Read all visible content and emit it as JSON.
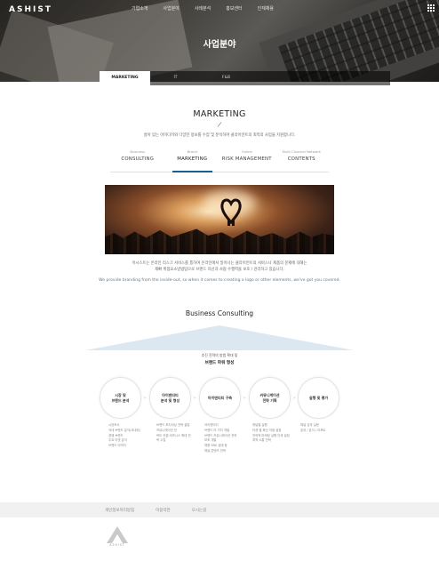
{
  "header": {
    "logo": "ASHIST",
    "nav": [
      "기업소개",
      "사업분야",
      "사례분석",
      "홍보센터",
      "인재채용"
    ],
    "menu_icon": "grid-menu-icon",
    "hero_title": "사업분야"
  },
  "tabs": [
    "MARKETING",
    "IT",
    "F&B"
  ],
  "section": {
    "title": "MARKETING",
    "description": "살아 있는 아이디어와 다양한 정보를 수집 및 분석하여 클라이언트의 최적의 사업을 지원합니다."
  },
  "subtabs": [
    {
      "small": "Business",
      "big": "CONSULTING"
    },
    {
      "small": "Brand",
      "big": "MARKETING"
    },
    {
      "small": "Online",
      "big": "RISK MANAGEMENT"
    },
    {
      "small": "Multi Channel Network",
      "big": "CONTENTS"
    }
  ],
  "body_text": [
    "어시스트는 온라인 리스크 서비스를 통하여 온라인에서 일어나는 클라이언트의 서비스나 제품의 문제에 대해는",
    "재빠 위험요소방법탐으로 브랜드 자산과 사람 수행력을 보호 / 관리하고 있습니다."
  ],
  "body_en": "We provide branding from the inside-out, so when it comes to creating a logo or other elements, we've got you covered.",
  "consulting": {
    "title": "Business Consulting",
    "core_sub": "추진 전략의 방법 확대 및",
    "core_main": "브랜드 파워 형성",
    "steps": [
      "시장 및\n브랜드 분석",
      "아이덴티티\n분석 및 형성",
      "아이덴티티 구축",
      "커뮤니케이션\n전략 기획",
      "실행 및 평가"
    ],
    "step_descs": [
      "시장조사\n국내 브랜드 분석(국내외)\n경쟁 브랜드\n주요 타겟 분석\n브랜드 이미지",
      "브랜드 포지셔닝 전략 설립\n커뮤니케이션 전\n략도 컨셉 비즈니스 확대 전\n략 수립",
      "아이덴티티\n브랜드 미 가치 개발\n브랜드 커뮤니케이션 전략\n보조 개발\n채용 SNS 상태 등\n채널 콘텐츠 전략",
      "채널별 실행\n타겟 별 확산 지점 설정\n전략적 마케팅 실행 단계 설정\n최적 소통 전략",
      "채널 성과 실현\n효과 / 분석 / 리포트"
    ]
  },
  "footer": {
    "links": [
      "개인정보처리방침",
      "이용약관",
      "오시는길"
    ],
    "logo_text": "ASHIST"
  },
  "colors": {
    "accent": "#1a5d8f",
    "pyramid": "#dbe7f1"
  }
}
